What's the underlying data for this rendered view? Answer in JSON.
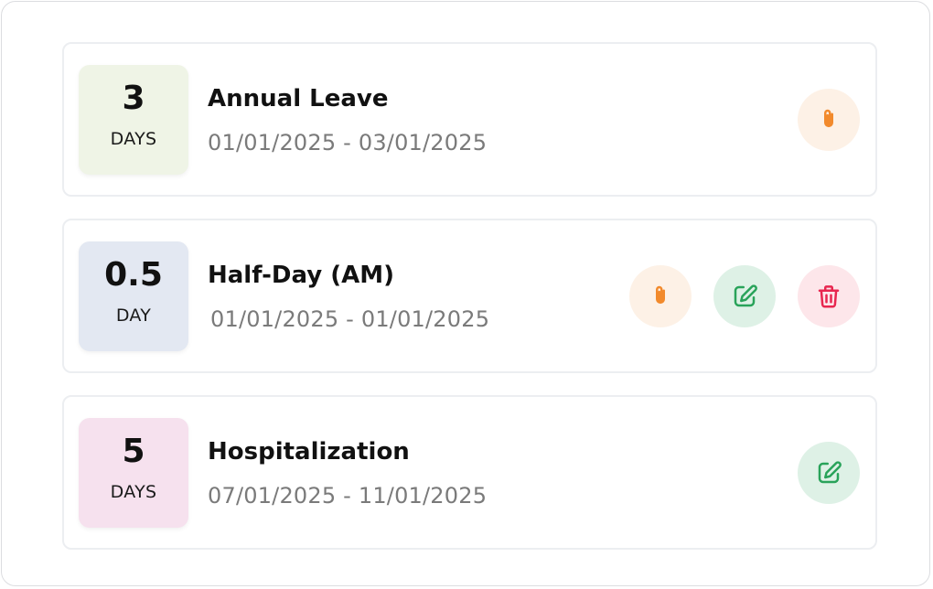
{
  "colors": {
    "badge_annual": "#eff4e6",
    "badge_halfday": "#e3e8f2",
    "badge_hospital": "#f6e1ee",
    "attach": "#f28a2c",
    "edit": "#29a35a",
    "delete": "#e8264f"
  },
  "leaves": [
    {
      "count": "3",
      "unit": "DAYS",
      "title": "Annual Leave",
      "dates": "01/01/2025 - 03/01/2025",
      "actions": [
        "paperclip-icon"
      ]
    },
    {
      "count": "0.5",
      "unit": "DAY",
      "title": "Half-Day (AM)",
      "dates": "01/01/2025 - 01/01/2025",
      "actions": [
        "paperclip-icon",
        "edit-icon",
        "trash-icon"
      ]
    },
    {
      "count": "5",
      "unit": "DAYS",
      "title": "Hospitalization",
      "dates": "07/01/2025 - 11/01/2025",
      "actions": [
        "edit-icon"
      ]
    }
  ]
}
